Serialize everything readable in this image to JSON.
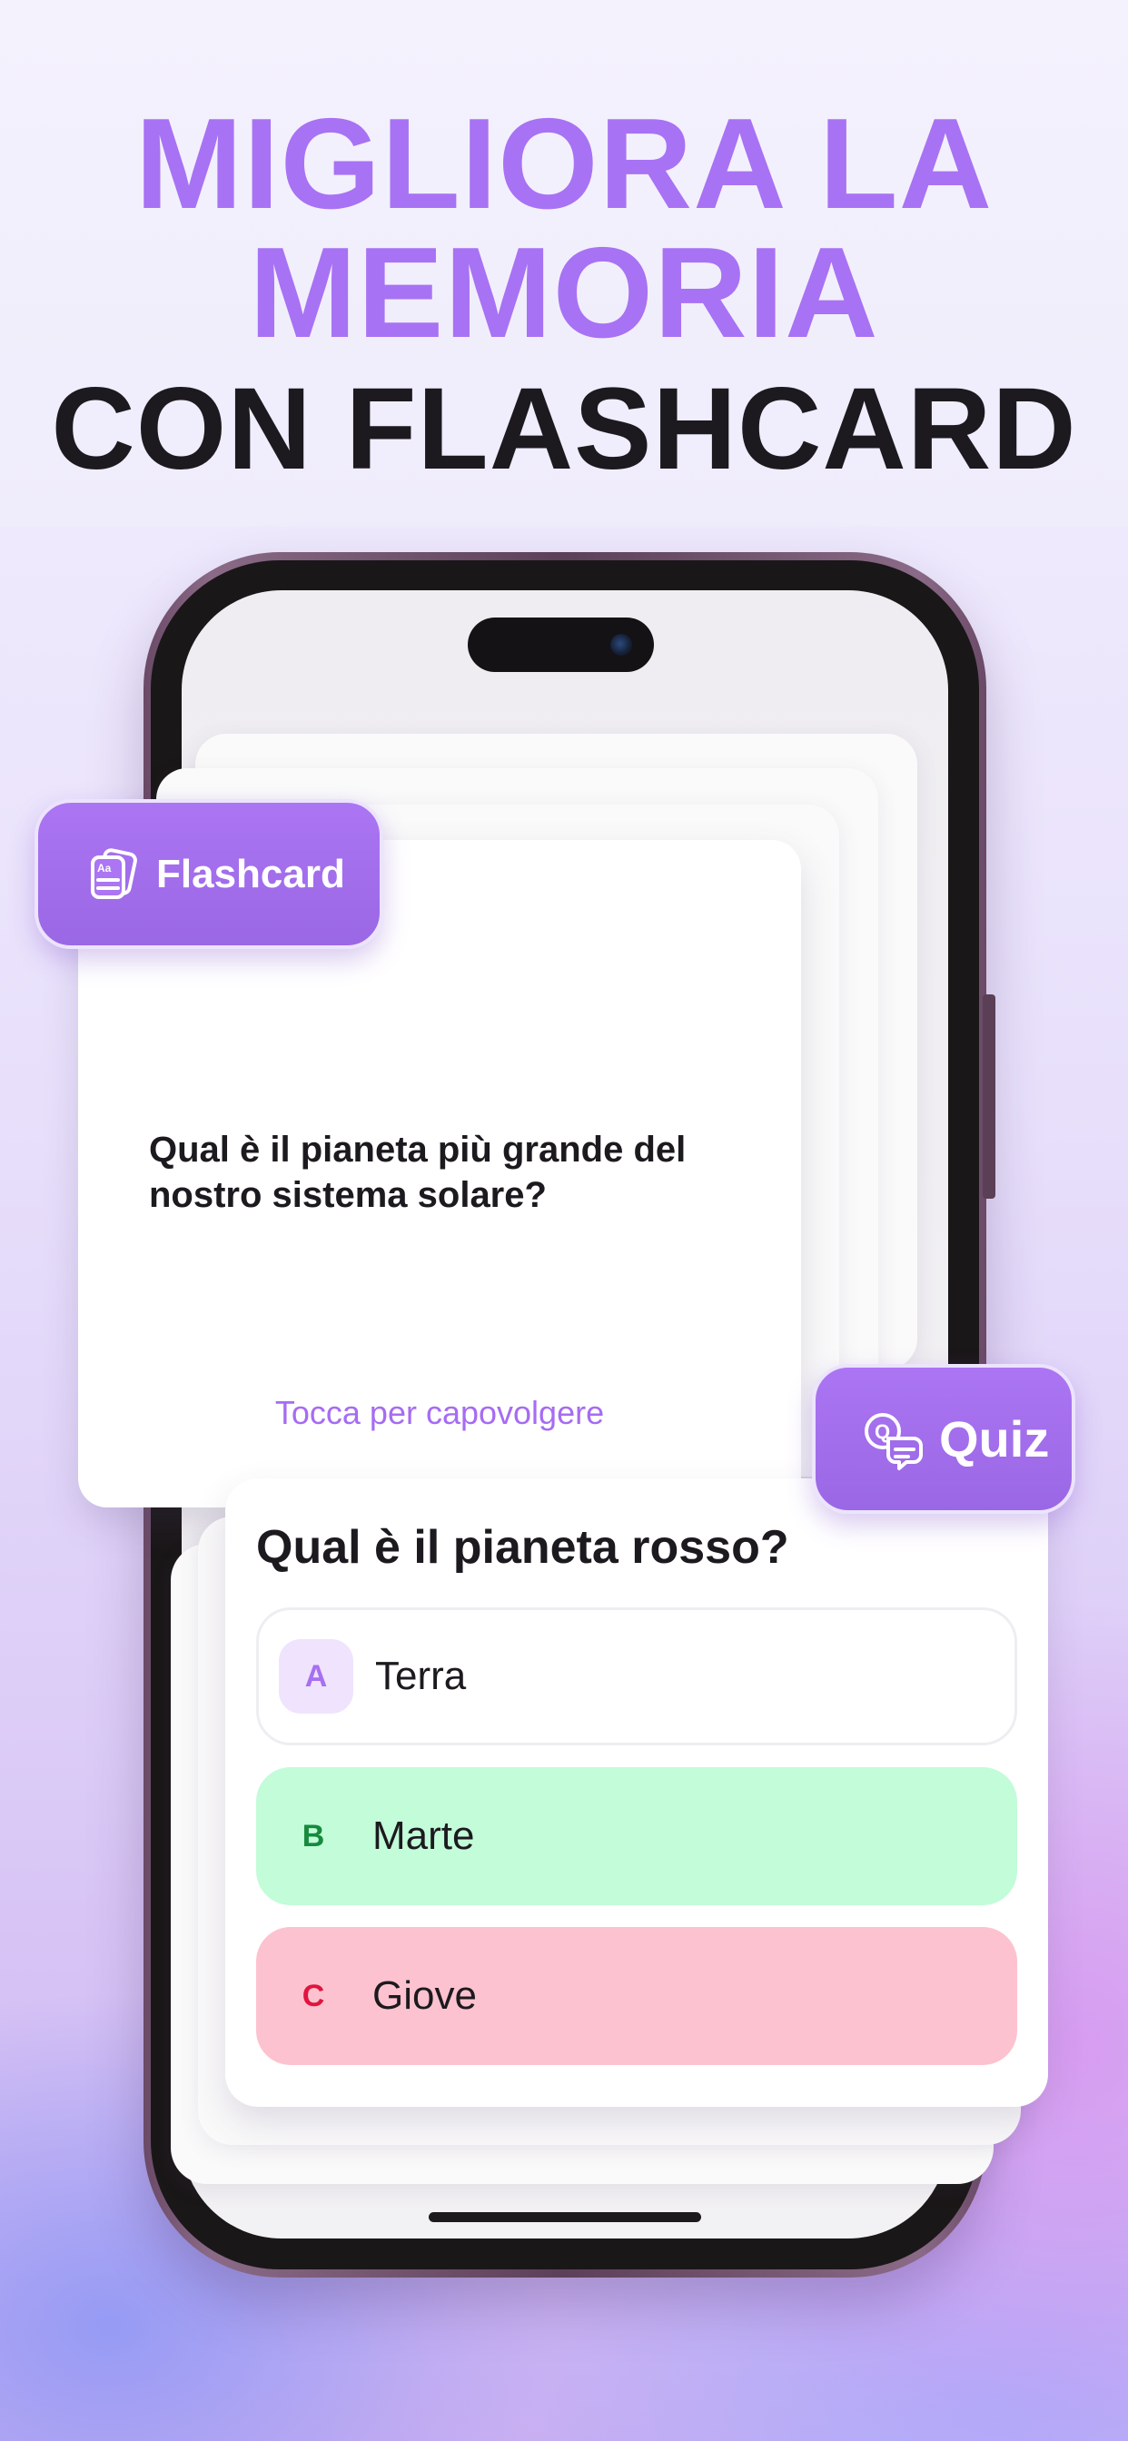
{
  "headline": {
    "line1": "MIGLIORA LA",
    "line2": "MEMORIA",
    "line3": "CON FLASHCARD"
  },
  "flashcard": {
    "badge_label": "Flashcard",
    "badge_icon": "flashcard-icon",
    "question": "Qual è il pianeta più grande del nostro sistema solare?",
    "hint": "Tocca per capovolgere"
  },
  "quiz": {
    "badge_label": "Quiz",
    "badge_icon": "quiz-chat-icon",
    "question": "Qual è il pianeta rosso?",
    "options": [
      {
        "letter": "A",
        "text": "Terra",
        "state": "neutral"
      },
      {
        "letter": "B",
        "text": "Marte",
        "state": "correct"
      },
      {
        "letter": "C",
        "text": "Giove",
        "state": "wrong"
      }
    ]
  },
  "colors": {
    "accent_purple": "#a872f4",
    "correct_bg": "#c2fcd8",
    "correct_letter": "#17893e",
    "wrong_bg": "#fdc2cf",
    "wrong_letter": "#e0153f"
  }
}
